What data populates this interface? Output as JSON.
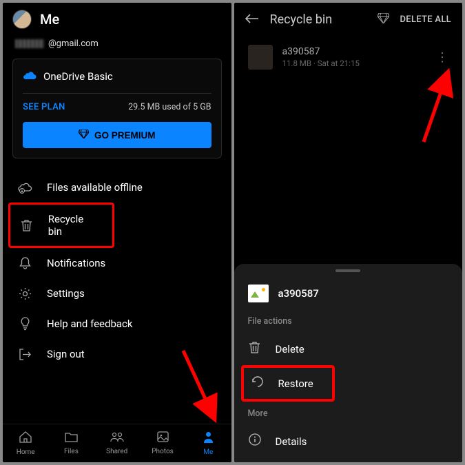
{
  "left": {
    "title": "Me",
    "email_suffix": "@gmail.com",
    "storage": {
      "plan_name": "OneDrive Basic",
      "see_plan": "SEE PLAN",
      "usage": "29.5 MB used of 5 GB",
      "premium_label": "GO PREMIUM"
    },
    "menu": {
      "offline": "Files available offline",
      "recycle": "Recycle bin",
      "notifications": "Notifications",
      "settings": "Settings",
      "help": "Help and feedback",
      "signout": "Sign out"
    },
    "nav": {
      "home": "Home",
      "files": "Files",
      "shared": "Shared",
      "photos": "Photos",
      "me": "Me"
    }
  },
  "right": {
    "title": "Recycle bin",
    "delete_all": "DELETE ALL",
    "file": {
      "name": "a390587",
      "meta": "11.8 MB · Sat at 21:15"
    },
    "sheet": {
      "file_name": "a390587",
      "section1": "File actions",
      "delete": "Delete",
      "restore": "Restore",
      "section2": "More",
      "details": "Details"
    }
  }
}
